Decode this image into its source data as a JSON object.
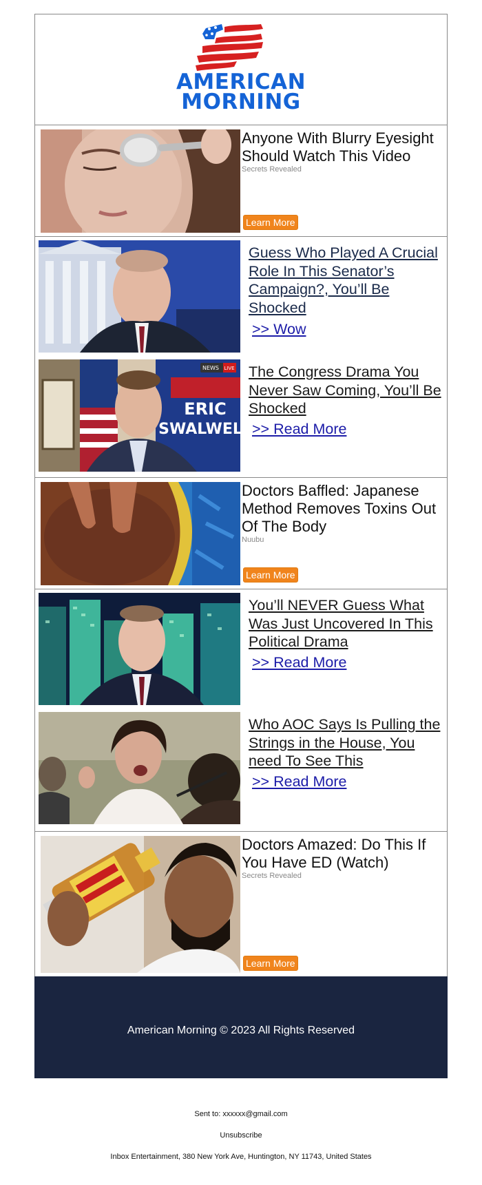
{
  "brand": {
    "name_line1": "AMERICAN",
    "name_line2": "MORNING",
    "accent_blue": "#1463d6",
    "accent_red": "#d62020"
  },
  "ads": [
    {
      "title": "Anyone With Blurry Eyesight Should Watch This Video",
      "source": "Secrets Revealed",
      "button": "Learn More",
      "image": "woman-spoon-eye"
    },
    {
      "title": "Doctors Baffled: Japanese Method Removes Toxins Out Of The Body",
      "source": "Nuubu",
      "button": "Learn More",
      "image": "feet-soak-basin"
    },
    {
      "title": "Doctors Amazed: Do This If You Have ED (Watch)",
      "source": "Secrets Revealed",
      "button": "Learn More",
      "image": "man-drinking-vinegar"
    }
  ],
  "stories": [
    {
      "headline": "Guess Who Played A Crucial Role In This Senator’s Campaign?, You’ll Be Shocked",
      "link": ">> Wow",
      "image": "senator-capitol"
    },
    {
      "headline": "The Congress Drama You Never Saw Coming, You’ll Be Shocked",
      "link": ">> Read More",
      "image": "congressman-news",
      "badge": "NEWS LIVE",
      "sign_text": "ERIC SWALWELL"
    },
    {
      "headline": "You’ll NEVER Guess What Was Just Uncovered In This Political Drama",
      "link": ">> Read More",
      "image": "senator-city-night"
    },
    {
      "headline": "Who AOC Says Is Pulling the Strings in the House, You need To See This",
      "link": ">> Read More",
      "image": "congresswoman-speaking"
    }
  ],
  "footer": {
    "copyright": "American Morning © 2023 All Rights Reserved",
    "background": "#1a2540"
  },
  "meta": {
    "sent_to": "Sent to: xxxxxx@gmail.com",
    "unsubscribe": "Unsubscribe",
    "address": "Inbox Entertainment, 380 New York Ave, Huntington, NY 11743, United States"
  }
}
